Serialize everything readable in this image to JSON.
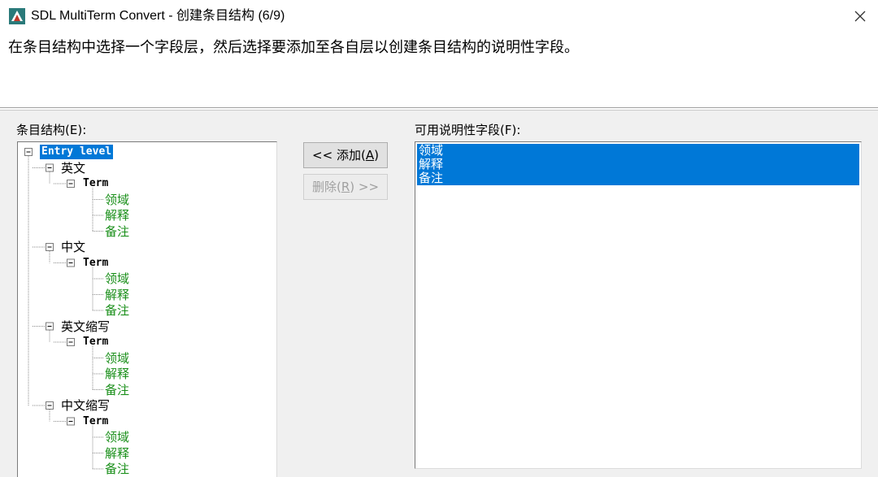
{
  "window": {
    "title": "SDL MultiTerm Convert - 创建条目结构 (6/9)",
    "instruction": "在条目结构中选择一个字段层，然后选择要添加至各自层以创建条目结构的说明性字段。"
  },
  "icons": {
    "app": "sdl-multiterm-icon",
    "close": "close-icon"
  },
  "colors": {
    "selection": "#0078d7",
    "field_text": "#1a8f1a"
  },
  "entry_structure": {
    "label": "条目结构",
    "label_suffix": "(E):",
    "root": "Entry level",
    "languages": [
      {
        "name": "英文",
        "term": "Term",
        "fields": [
          "领域",
          "解释",
          "备注"
        ]
      },
      {
        "name": "中文",
        "term": "Term",
        "fields": [
          "领域",
          "解释",
          "备注"
        ]
      },
      {
        "name": "英文缩写",
        "term": "Term",
        "fields": [
          "领域",
          "解释",
          "备注"
        ]
      },
      {
        "name": "中文缩写",
        "term": "Term",
        "fields": [
          "领域",
          "解释",
          "备注"
        ]
      }
    ]
  },
  "buttons": {
    "add_prefix": "<< 添加(",
    "add_key": "A",
    "add_suffix": ")",
    "remove_prefix": "删除(",
    "remove_key": "R",
    "remove_suffix": ") >>"
  },
  "available_fields": {
    "label": "可用说明性字段",
    "label_suffix": "(F):",
    "items": [
      "领域",
      "解释",
      "备注"
    ]
  }
}
